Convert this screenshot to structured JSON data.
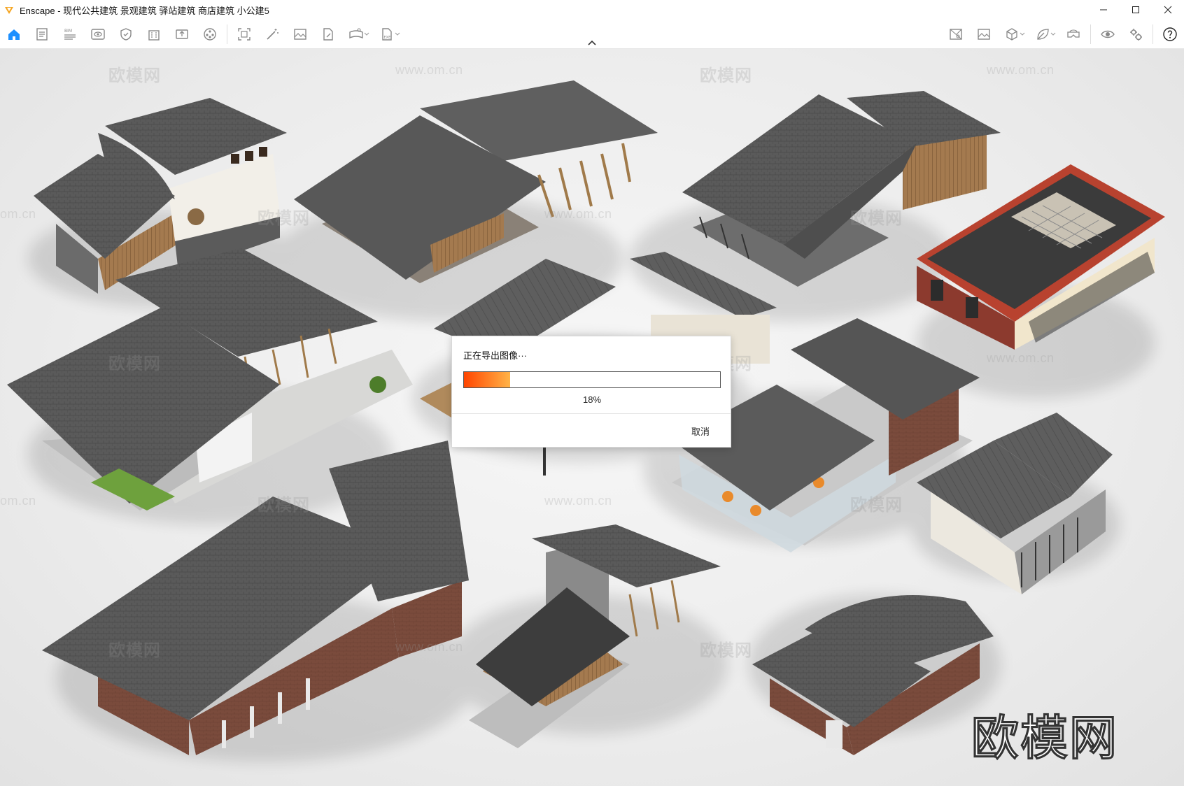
{
  "window": {
    "title": "Enscape - 现代公共建筑 景观建筑 驿站建筑 商店建筑 小公建5",
    "controls": [
      "minimize-icon",
      "maximize-icon",
      "close-icon"
    ]
  },
  "toolbar": {
    "left_icons": [
      "home-icon",
      "document-icon",
      "bim-icon",
      "view-icon",
      "shield-icon",
      "building-icon",
      "camera-upload-icon",
      "material-icon",
      "capture-icon",
      "magic-wand-icon",
      "image-icon",
      "document-edit-icon",
      "panorama-icon",
      "export-icon"
    ],
    "right_icons": [
      "map-icon",
      "landscape-icon",
      "cube-icon",
      "leaf-icon",
      "vr-icon",
      "visibility-icon",
      "settings-icon",
      "help-icon"
    ],
    "accent_color": "#1e90ff"
  },
  "watermarks": {
    "brand": "欧模网",
    "url": "www.om.cn",
    "partial_url": "om.cn"
  },
  "dialog": {
    "title": "正在导出图像···",
    "progress_percent": 18,
    "progress_label": "18%",
    "cancel_label": "取消",
    "progress_colors": [
      "#ff4500",
      "#ffb347"
    ]
  }
}
